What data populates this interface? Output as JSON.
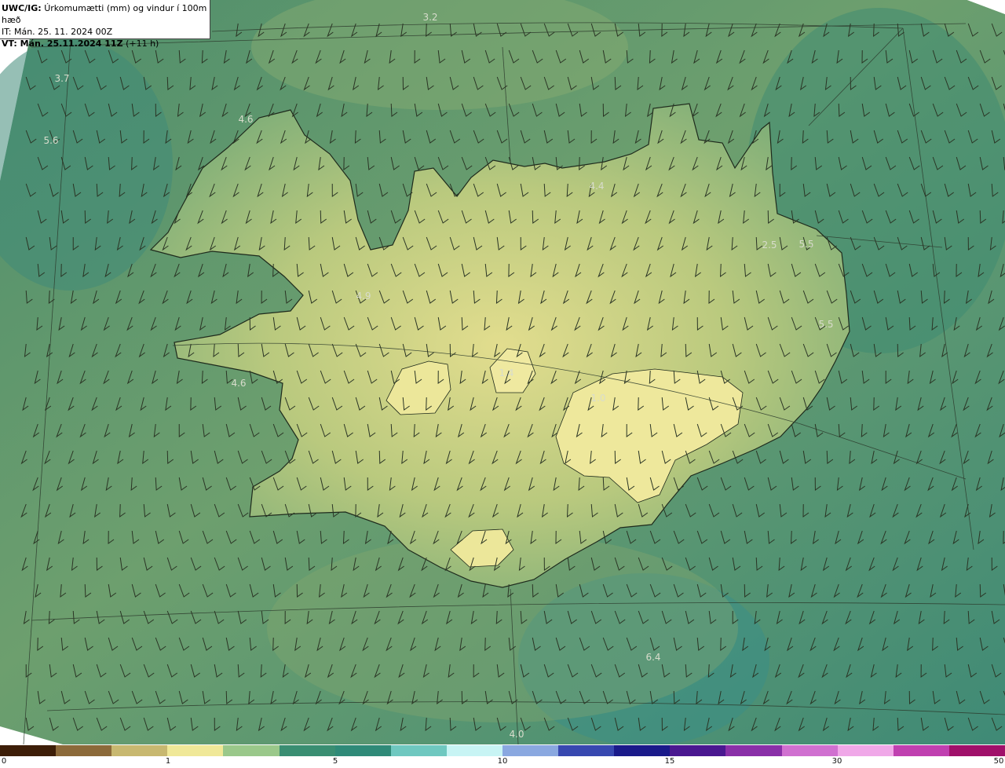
{
  "header": {
    "model": "UWC/IG:",
    "title": "Úrkomumætti (mm) og vindur í 100m hæð",
    "init_time": "IT: Mán. 25. 11. 2024 00Z",
    "valid_prefix": "VT: Mán. 25.11.2024 11Z",
    "valid_offset": "(+11 h)"
  },
  "labels": [
    {
      "text": "3.2"
    },
    {
      "text": "3.7"
    },
    {
      "text": "4.6"
    },
    {
      "text": "5.6"
    },
    {
      "text": "4.4"
    },
    {
      "text": "2.5"
    },
    {
      "text": "5.5"
    },
    {
      "text": "4.9"
    },
    {
      "text": "5.5"
    },
    {
      "text": "4.6"
    },
    {
      "text": "1.0"
    },
    {
      "text": "1.4"
    },
    {
      "text": "6.4"
    },
    {
      "text": "4.0"
    }
  ],
  "colorbar": {
    "ticks": [
      "0",
      "1",
      "5",
      "10",
      "15",
      "30",
      "50"
    ],
    "colors": [
      "#3d1e08",
      "#8c6a3a",
      "#c8b870",
      "#f0e898",
      "#9ac88a",
      "#3a8e72",
      "#2f8a78",
      "#6fc8c0",
      "#c8f4f4",
      "#8aa8e0",
      "#3848b0",
      "#1a1a8a",
      "#4a1890",
      "#8a30a8",
      "#d070d0",
      "#f0a8e8",
      "#c040b0",
      "#a0106a"
    ]
  }
}
